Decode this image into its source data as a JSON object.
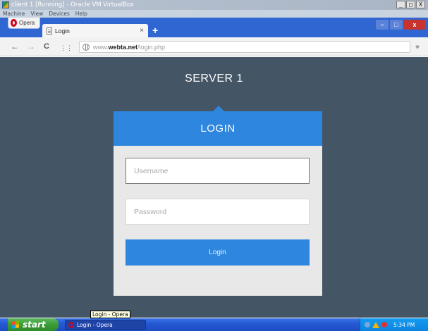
{
  "vm_window": {
    "title": "client 1 [Running] - Oracle VM VirtualBox",
    "menu": [
      "Machine",
      "View",
      "Devices",
      "Help"
    ],
    "controls": [
      "_",
      "□",
      "X"
    ]
  },
  "browser": {
    "opera_label": "Opera",
    "tab_title": "Login",
    "tab_close": "×",
    "new_tab": "+",
    "window_buttons": {
      "minimize": "–",
      "maximize": "□",
      "close": "x"
    },
    "nav": {
      "back": "←",
      "forward": "→",
      "reload": "C",
      "speed_dial": "⋮⋮"
    },
    "url": {
      "prefix": "www.",
      "domain": "webta.net",
      "path": "/login.php"
    },
    "heart": "♥"
  },
  "page": {
    "server_title": "SERVER 1",
    "login_heading": "LOGIN",
    "username_placeholder": "Username",
    "password_placeholder": "Password",
    "login_button": "Login",
    "accent_color": "#2e86de",
    "background_color": "#445566"
  },
  "tooltip": "Login - Opera",
  "taskbar": {
    "start_label": "start",
    "task_label": "Login - Opera",
    "clock": "5:34 PM"
  }
}
